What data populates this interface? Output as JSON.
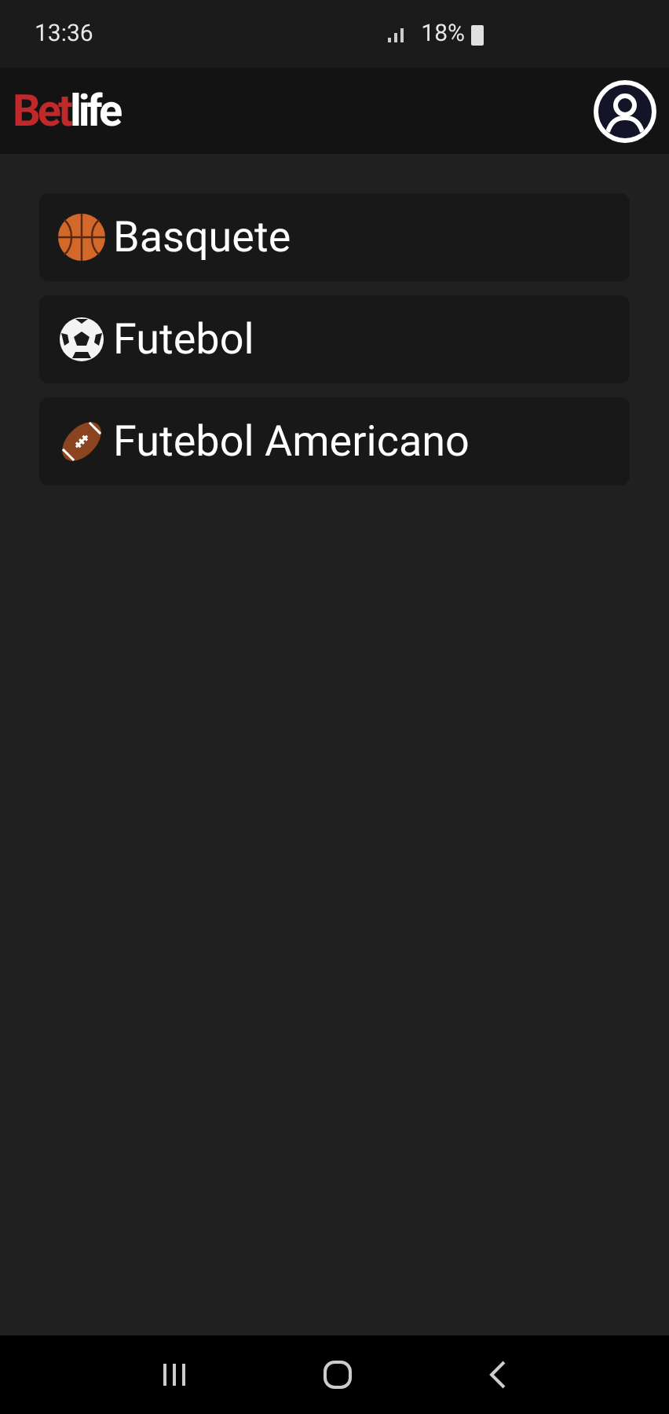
{
  "status_bar": {
    "time": "13:36",
    "battery": "18%"
  },
  "header": {
    "logo": {
      "first": "Bet",
      "second": "life"
    }
  },
  "sports": [
    {
      "kind": "basketball",
      "label": "Basquete"
    },
    {
      "kind": "soccer",
      "label": "Futebol"
    },
    {
      "kind": "football",
      "label": "Futebol Americano"
    }
  ]
}
